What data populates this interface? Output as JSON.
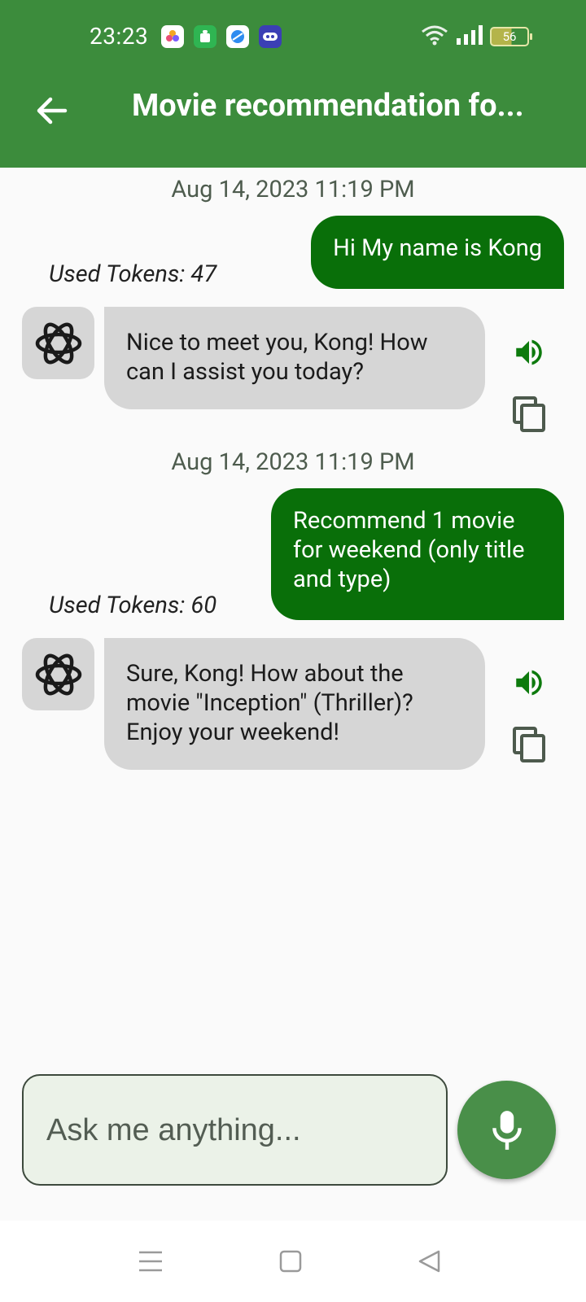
{
  "status_bar": {
    "time": "23:23",
    "battery_level": "56",
    "app_icons": [
      "photos-app-icon",
      "android-app-icon",
      "browser-app-icon",
      "game-app-icon"
    ]
  },
  "header": {
    "title": "Movie recommendation fo...",
    "background_color": "#3c8c3c",
    "back_icon": "arrow-left-icon"
  },
  "messages": [
    {
      "timestamp": "Aug 14, 2023 11:19 PM",
      "user_text": "Hi My name is Kong",
      "used_tokens": "Used Tokens: 47",
      "bot_text": "Nice to meet you, Kong! How can I assist you today?"
    },
    {
      "timestamp": "Aug 14, 2023 11:19 PM",
      "user_text": "Recommend 1 movie for weekend (only title and type)",
      "used_tokens": "Used Tokens: 60",
      "bot_text": "Sure, Kong! How about the movie \"Inception\" (Thriller)? Enjoy your weekend!"
    }
  ],
  "composer": {
    "placeholder": "Ask me anything...",
    "value": ""
  },
  "colors": {
    "user_bubble": "#096f09",
    "bot_bubble": "#d6d6d6",
    "accent_icon": "#0d7a0d",
    "mic_button": "#498f49"
  }
}
